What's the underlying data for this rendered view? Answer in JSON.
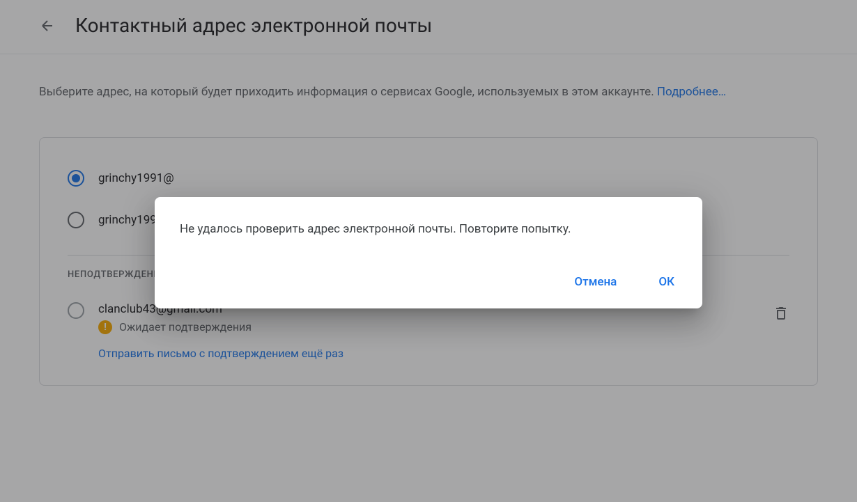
{
  "header": {
    "title": "Контактный адрес электронной почты"
  },
  "description": {
    "text": "Выберите адрес, на который будет приходить информация о сервисах Google, используемых в этом аккаунте. ",
    "learn_more": "Подробнее…"
  },
  "emails": {
    "option1": "grinchy1991@",
    "option2": "grinchy1991@"
  },
  "unverified": {
    "section_title": "НЕПОДТВЕРЖДЕННЫЕ АДРЕСА ЭЛЕКТРОННОЙ ПОЧТЫ",
    "email": "clanclub43@gmail.com",
    "status": "Ожидает подтверждения",
    "resend": "Отправить письмо с подтверждением ещё раз"
  },
  "dialog": {
    "message": "Не удалось проверить адрес электронной почты. Повторите попытку.",
    "cancel": "Отмена",
    "ok": "ОК"
  }
}
